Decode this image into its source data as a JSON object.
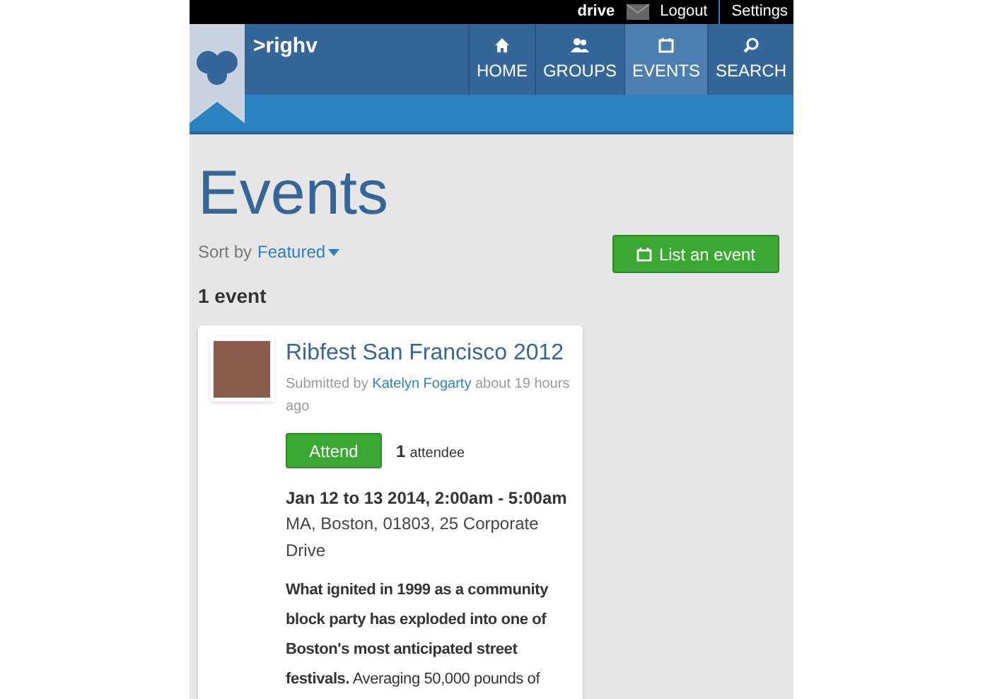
{
  "top_bar": {
    "user": "drive",
    "links": [
      "Logout",
      "Settings"
    ]
  },
  "header": {
    "logo": ">righv",
    "nav": [
      {
        "label": "HOME",
        "selected": false
      },
      {
        "label": "GROUPS",
        "selected": false
      },
      {
        "label": "EVENTS",
        "selected": true
      },
      {
        "label": "SEARCH",
        "selected": false
      }
    ]
  },
  "page": {
    "title": "Events",
    "sort_label": "Sort by",
    "sort_value": "Featured",
    "list_button": "List an event",
    "count": "1 event"
  },
  "event": {
    "title": "Ribfest San Francisco 2012",
    "submitted_prefix": "Submitted by",
    "author": "Katelyn Fogarty",
    "submitted_suffix": "about 19 hours ago",
    "attend_button": "Attend",
    "attendee_count": "1",
    "attendee_label": "attendee",
    "date": "Jan 12 to 13 2014, 2:00am - 5:00am",
    "address": "MA, Boston, 01803, 25 Corporate Drive",
    "description": "**What ignited in 1999 as a community block party has exploded into one of Boston's most anticipated street festivals.** Averaging 50,000 pounds of"
  }
}
